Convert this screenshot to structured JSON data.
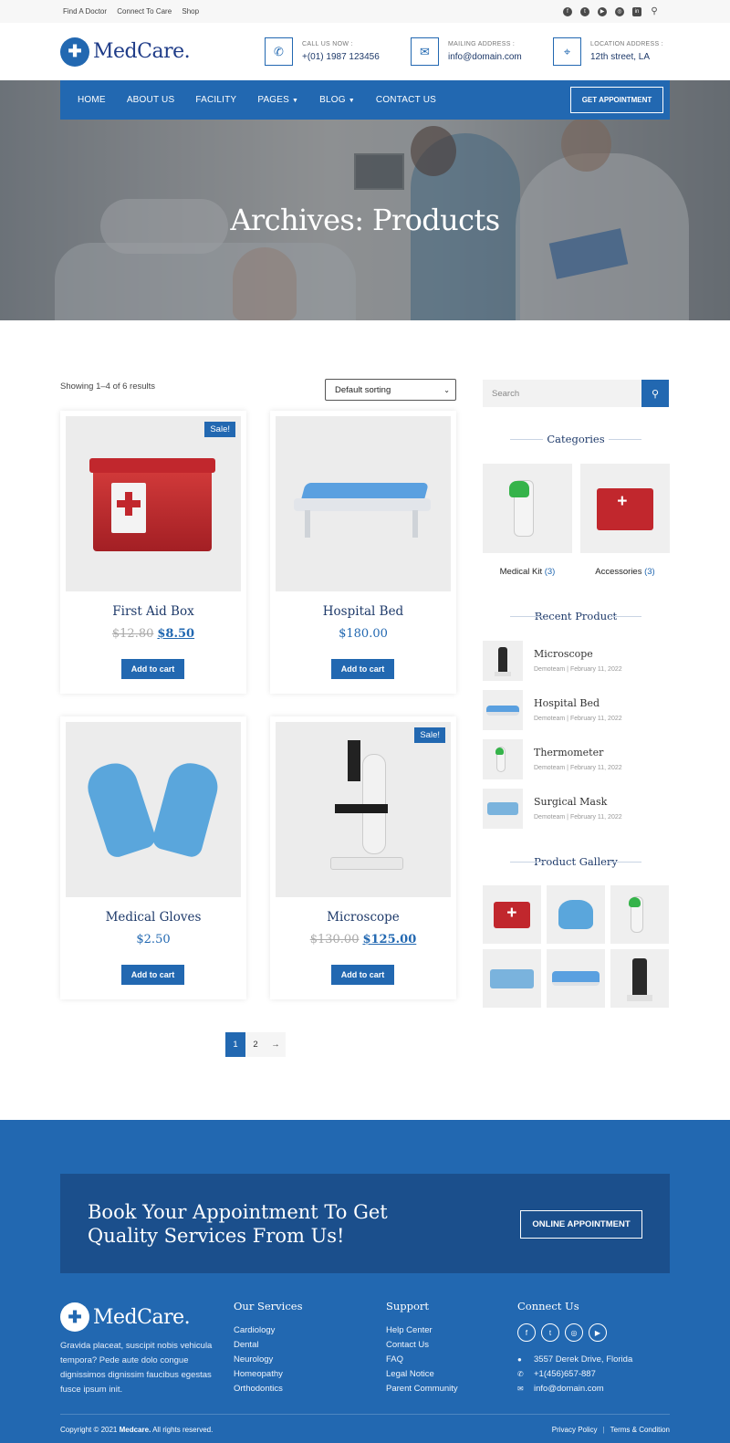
{
  "topbar": {
    "links": [
      "Find A Doctor",
      "Connect To Care",
      "Shop"
    ],
    "social_icons": [
      "facebook-icon",
      "twitter-icon",
      "youtube-icon",
      "instagram-icon",
      "linkedin-icon",
      "search-icon"
    ]
  },
  "header": {
    "logo_text": "MedCare.",
    "call": {
      "label": "CALL US NOW :",
      "value": "+(01) 1987 123456"
    },
    "mail": {
      "label": "MAILING ADDRESS :",
      "value": "info@domain.com"
    },
    "location": {
      "label": "LOCATION ADDRESS :",
      "value": "12th street, LA"
    }
  },
  "nav": {
    "items": [
      "HOME",
      "ABOUT US",
      "FACILITY",
      "PAGES",
      "BLOG",
      "CONTACT US"
    ],
    "cta": "GET APPOINTMENT"
  },
  "hero": {
    "title": "Archives: Products"
  },
  "shop": {
    "results_text": "Showing 1–4 of 6 results",
    "sort_value": "Default sorting",
    "products": [
      {
        "name": "First Aid Box",
        "old_price": "$12.80",
        "price": "$8.50",
        "sale": "Sale!",
        "button": "Add to cart"
      },
      {
        "name": "Hospital Bed",
        "old_price": "",
        "price": "$180.00",
        "sale": "",
        "button": "Add to cart"
      },
      {
        "name": "Medical Gloves",
        "old_price": "",
        "price": "$2.50",
        "sale": "",
        "button": "Add to cart"
      },
      {
        "name": "Microscope",
        "old_price": "$130.00",
        "price": "$125.00",
        "sale": "Sale!",
        "button": "Add to cart"
      }
    ],
    "pagination": [
      "1",
      "2",
      "→"
    ]
  },
  "sidebar": {
    "search_placeholder": "Search",
    "categories_title": "Categories",
    "categories": [
      {
        "name": "Medical Kit",
        "count": "(3)"
      },
      {
        "name": "Accessories",
        "count": "(3)"
      }
    ],
    "recent_title": "Recent Product",
    "recent": [
      {
        "title": "Microscope",
        "meta": "Demoteam | February 11, 2022"
      },
      {
        "title": "Hospital Bed",
        "meta": "Demoteam | February 11, 2022"
      },
      {
        "title": "Thermometer",
        "meta": "Demoteam | February 11, 2022"
      },
      {
        "title": "Surgical Mask",
        "meta": "Demoteam | February 11, 2022"
      }
    ],
    "gallery_title": "Product Gallery"
  },
  "footer": {
    "cta_heading": "Book Your Appointment To Get Quality Services From Us!",
    "cta_button": "ONLINE APPOINTMENT",
    "logo_text": "MedCare.",
    "description": "Gravida placeat, suscipit nobis vehicula tempora? Pede aute dolo congue dignissimos dignissim faucibus egestas fusce ipsum init.",
    "services": {
      "title": "Our Services",
      "items": [
        "Cardiology",
        "Dental",
        "Neurology",
        "Homeopathy",
        "Orthodontics"
      ]
    },
    "support": {
      "title": "Support",
      "items": [
        "Help Center",
        "Contact Us",
        "FAQ",
        "Legal Notice",
        "Parent Community"
      ]
    },
    "connect": {
      "title": "Connect Us",
      "address": "3557 Derek Drive, Florida",
      "phone": "+1(456)657-887",
      "email": "info@domain.com"
    },
    "copyright_prefix": "Copyright © 2021 ",
    "copyright_brand": "Medcare.",
    "copyright_suffix": " All rights reserved.",
    "privacy": "Privacy Policy",
    "terms": "Terms & Condition"
  },
  "colors": {
    "primary": "#2268b1",
    "dark_blue": "#1b4f8c",
    "sale_red": "#c1272d"
  }
}
